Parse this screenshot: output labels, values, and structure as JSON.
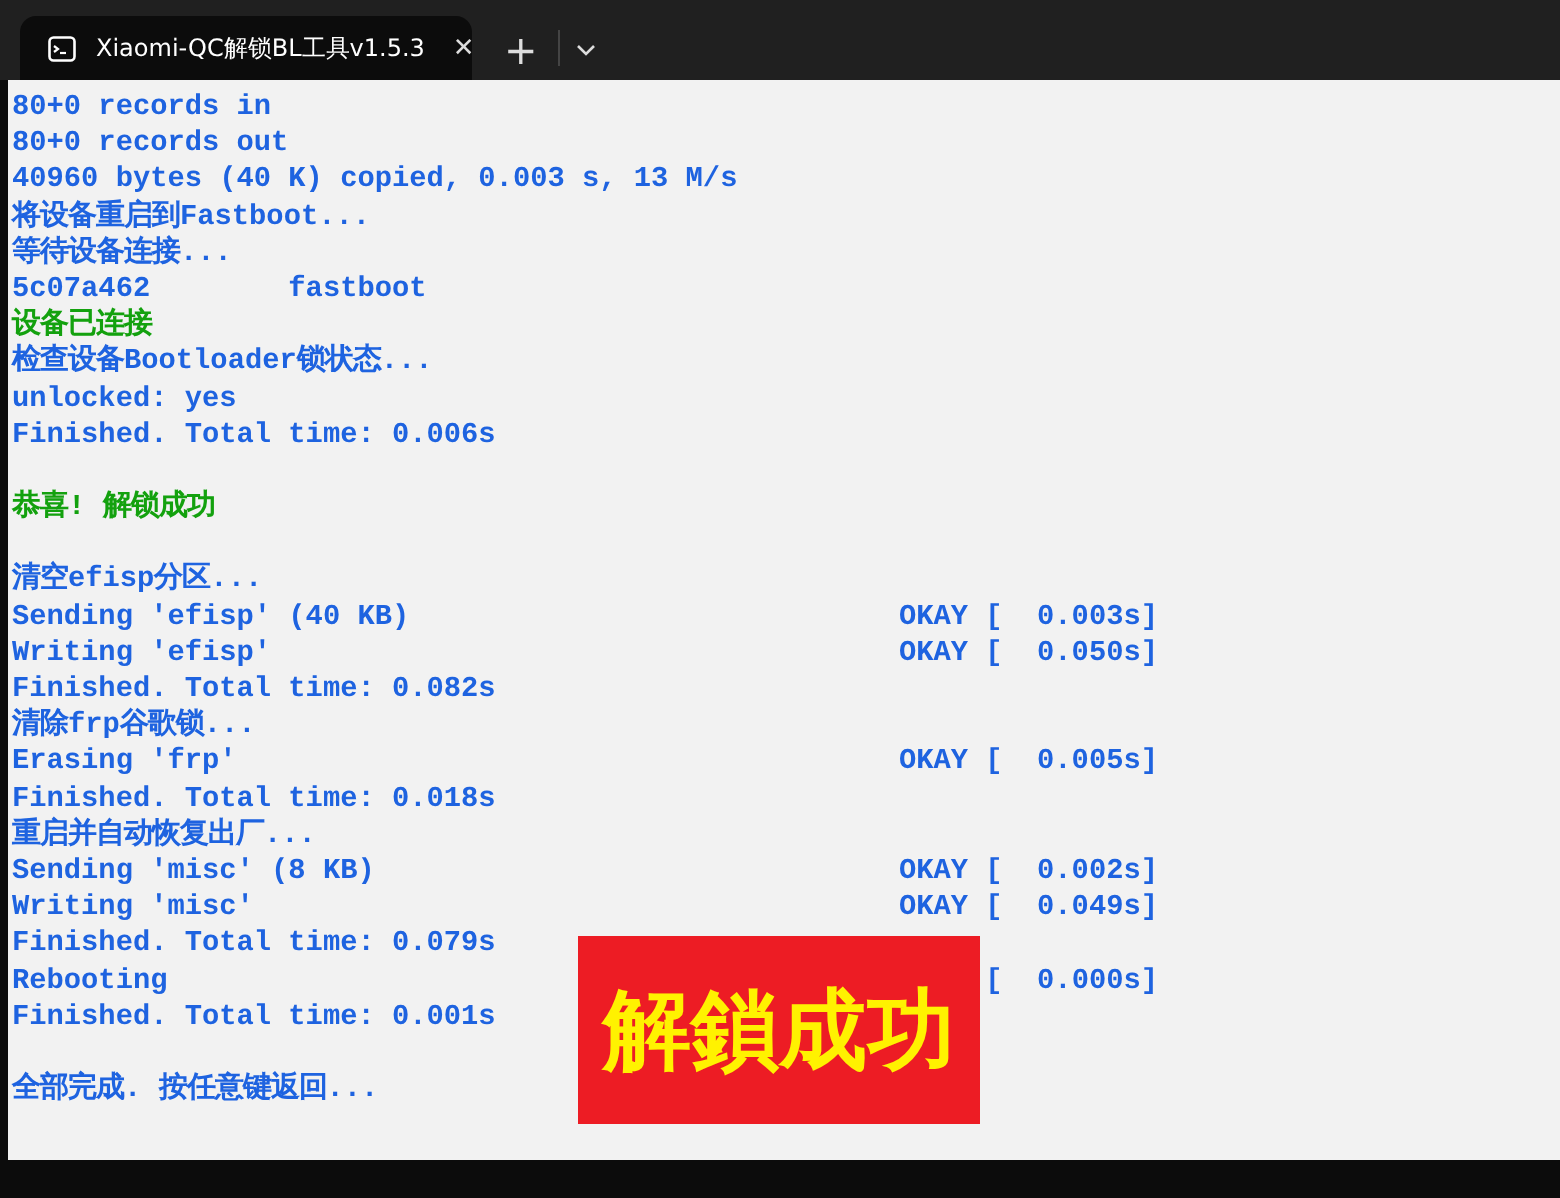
{
  "window": {
    "tab_title": "Xiaomi-QC解锁BL工具v1.5.3",
    "close": "✕",
    "new_tab": "+"
  },
  "console": {
    "lines": [
      {
        "kind": "info",
        "text": "80+0 records in"
      },
      {
        "kind": "info",
        "text": "80+0 records out"
      },
      {
        "kind": "info",
        "text": "40960 bytes (40 K) copied, 0.003 s, 13 M/s"
      },
      {
        "kind": "info",
        "text": "将设备重启到Fastboot..."
      },
      {
        "kind": "info",
        "text": "等待设备连接..."
      },
      {
        "kind": "info",
        "text": "5c07a462        fastboot"
      },
      {
        "kind": "success",
        "text": "设备已连接"
      },
      {
        "kind": "info",
        "text": "检查设备Bootloader锁状态..."
      },
      {
        "kind": "info",
        "text": "unlocked: yes"
      },
      {
        "kind": "info",
        "text": "Finished. Total time: 0.006s"
      },
      {
        "kind": "blank"
      },
      {
        "kind": "success",
        "text": "恭喜! 解锁成功"
      },
      {
        "kind": "blank"
      },
      {
        "kind": "info",
        "text": "清空efisp分区..."
      },
      {
        "kind": "info",
        "text": "Sending 'efisp' (40 KB)",
        "status": "OKAY [  0.003s]"
      },
      {
        "kind": "info",
        "text": "Writing 'efisp'",
        "status": "OKAY [  0.050s]"
      },
      {
        "kind": "info",
        "text": "Finished. Total time: 0.082s"
      },
      {
        "kind": "info",
        "text": "清除frp谷歌锁..."
      },
      {
        "kind": "info",
        "text": "Erasing 'frp'",
        "status": "OKAY [  0.005s]"
      },
      {
        "kind": "info",
        "text": "Finished. Total time: 0.018s"
      },
      {
        "kind": "info",
        "text": "重启并自动恢复出厂..."
      },
      {
        "kind": "info",
        "text": "Sending 'misc' (8 KB)",
        "status": "OKAY [  0.002s]"
      },
      {
        "kind": "info",
        "text": "Writing 'misc'",
        "status": "OKAY [  0.049s]"
      },
      {
        "kind": "info",
        "text": "Finished. Total time: 0.079s"
      },
      {
        "kind": "info",
        "text": "Rebooting",
        "status": "[  0.000s]"
      },
      {
        "kind": "info",
        "text": "Finished. Total time: 0.001s"
      },
      {
        "kind": "blank"
      },
      {
        "kind": "info",
        "text": "全部完成. 按任意键返回..."
      }
    ]
  },
  "overlay": {
    "text": "解鎖成功"
  }
}
